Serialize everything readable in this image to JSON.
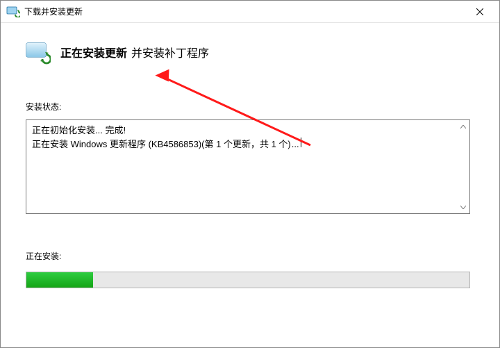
{
  "titlebar": {
    "title": "下载并安装更新"
  },
  "header": {
    "bold": "正在安装更新",
    "light": "并安装补丁程序"
  },
  "status": {
    "label": "安装状态:",
    "line1": "正在初始化安装... 完成!",
    "line2": "正在安装 Windows 更新程序 (KB4586853)(第 1 个更新，共 1 个)",
    "dots": "..."
  },
  "installing": {
    "label": "正在安装:"
  },
  "icons": {
    "title_icon": "update-icon",
    "big_icon": "update-screen-icon",
    "close": "close-icon",
    "scroll_up": "chevron-up-icon",
    "scroll_down": "chevron-down-icon"
  }
}
